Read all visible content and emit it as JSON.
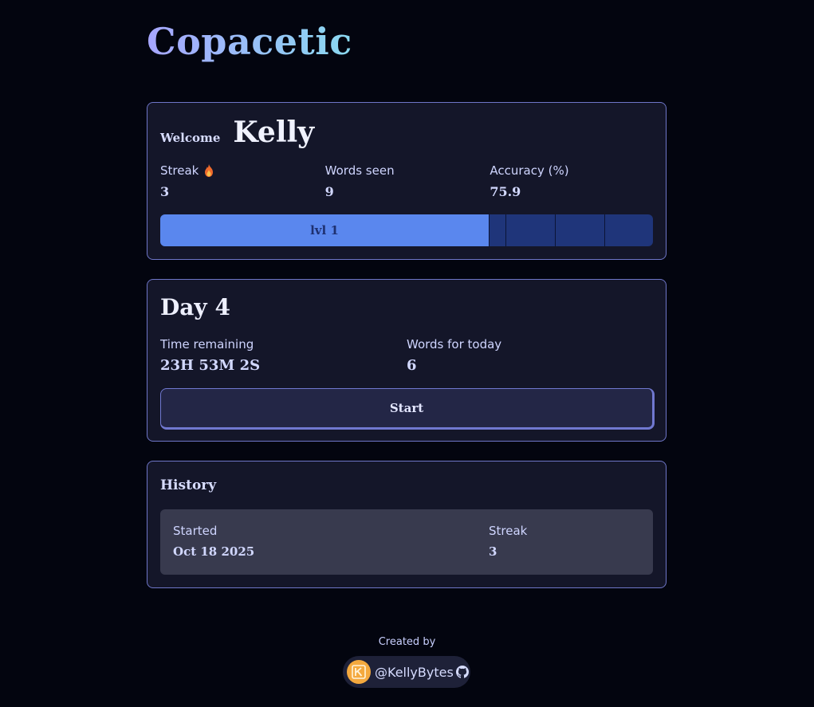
{
  "app": {
    "title": "Copacetic"
  },
  "welcome": {
    "greeting": "Welcome",
    "name": "Kelly",
    "stats": [
      {
        "label": "Streak",
        "icon": "flame-icon",
        "value": "3"
      },
      {
        "label": "Words seen",
        "value": "9"
      },
      {
        "label": "Accuracy (%)",
        "value": "75.9"
      }
    ],
    "level": {
      "label": "lvl 1",
      "progress_fraction": 0.667
    }
  },
  "day": {
    "title": "Day 4",
    "time_remaining_label": "Time remaining",
    "time_remaining_value": "23H 53M 2S",
    "words_today_label": "Words for today",
    "words_today_value": "6",
    "start_label": "Start"
  },
  "history": {
    "title": "History",
    "columns": [
      "Started",
      "Streak"
    ],
    "rows": [
      {
        "started": "Oct 18 2025",
        "streak": "3"
      }
    ]
  },
  "footer": {
    "created_by": "Created by",
    "handle": "@KellyBytes",
    "icons": [
      "avatar",
      "github-icon"
    ]
  },
  "colors": {
    "background": "#03050f",
    "card": "#141629",
    "card_border": "#6e76c8",
    "level_fill": "#5a87ee",
    "level_track": "#1f357a"
  }
}
